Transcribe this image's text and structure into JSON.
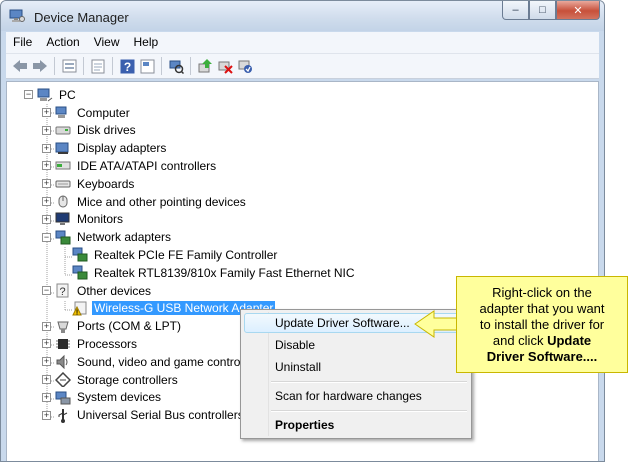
{
  "window": {
    "title": "Device Manager"
  },
  "title_buttons": [
    "–",
    "□",
    "✕"
  ],
  "menu": [
    "File",
    "Action",
    "View",
    "Help"
  ],
  "toolbar_icons": [
    "back-arrow-icon",
    "forward-arrow-icon",
    "properties-icon",
    "update-icon",
    "help-icon",
    "computer-view-icon",
    "scan-hardware-icon",
    "update-driver-icon",
    "uninstall-icon",
    "enable-icon"
  ],
  "tree": {
    "root": "PC",
    "nodes": [
      {
        "label": "Computer",
        "icon": "computer-icon",
        "expander": "+"
      },
      {
        "label": "Disk drives",
        "icon": "disk-drive-icon",
        "expander": "+"
      },
      {
        "label": "Display adapters",
        "icon": "display-adapter-icon",
        "expander": "+"
      },
      {
        "label": "IDE ATA/ATAPI controllers",
        "icon": "ide-controller-icon",
        "expander": "+"
      },
      {
        "label": "Keyboards",
        "icon": "keyboard-icon",
        "expander": "+"
      },
      {
        "label": "Mice and other pointing devices",
        "icon": "mouse-icon",
        "expander": "+"
      },
      {
        "label": "Monitors",
        "icon": "monitor-icon",
        "expander": "+"
      },
      {
        "label": "Network adapters",
        "icon": "network-adapter-icon",
        "expander": "−"
      },
      {
        "label": "Realtek PCIe FE Family Controller",
        "icon": "network-card-icon",
        "child": true
      },
      {
        "label": "Realtek RTL8139/810x Family Fast Ethernet NIC",
        "icon": "network-card-icon",
        "child": true
      },
      {
        "label": "Other devices",
        "icon": "other-devices-icon",
        "expander": "−"
      },
      {
        "label": "Wireless-G USB Network Adapter",
        "icon": "unknown-device-warning-icon",
        "child": true,
        "selected": true
      },
      {
        "label": "Ports (COM & LPT)",
        "icon": "port-icon",
        "expander": "+"
      },
      {
        "label": "Processors",
        "icon": "processor-icon",
        "expander": "+"
      },
      {
        "label": "Sound, video and game controllers",
        "icon": "sound-icon",
        "expander": "+"
      },
      {
        "label": "Storage controllers",
        "icon": "storage-controller-icon",
        "expander": "+"
      },
      {
        "label": "System devices",
        "icon": "system-device-icon",
        "expander": "+"
      },
      {
        "label": "Universal Serial Bus controllers",
        "icon": "usb-icon",
        "expander": "+"
      }
    ]
  },
  "context_menu": {
    "update": "Update Driver Software...",
    "disable": "Disable",
    "uninstall": "Uninstall",
    "scan": "Scan for hardware changes",
    "properties": "Properties"
  },
  "callout": {
    "line1": "Right-click on the",
    "line2": "adapter that you want",
    "line3": "to install the driver for",
    "line4": "and click",
    "bold1": "Update",
    "bold2": "Driver Software...."
  },
  "colors": {
    "selection": "#3399ff",
    "callout_bg": "#ffff9c",
    "window_frame": "#c9d9ec"
  }
}
